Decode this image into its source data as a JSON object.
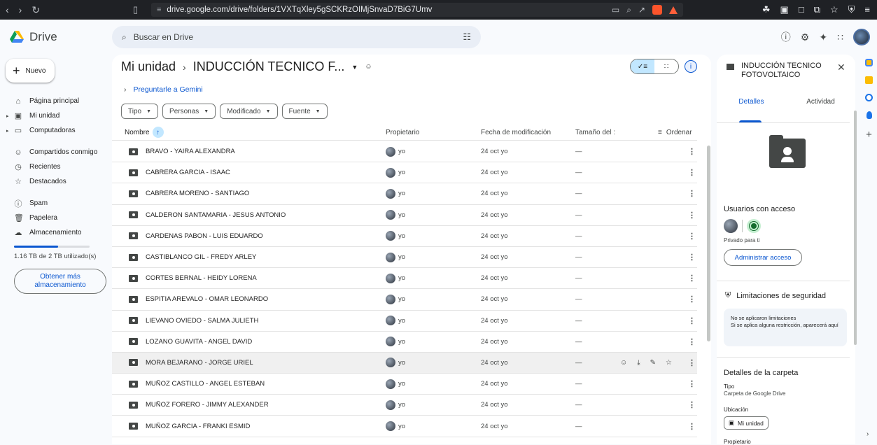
{
  "browser": {
    "url": "drive.google.com/drive/folders/1VXTqXley5gSCKRzOIMjSnvaD7BiG7Umv"
  },
  "header": {
    "app_name": "Drive",
    "search_placeholder": "Buscar en Drive"
  },
  "sidebar": {
    "new_label": "Nuevo",
    "items": [
      {
        "label": "Página principal",
        "icon": "home-icon"
      },
      {
        "label": "Mi unidad",
        "icon": "my-drive-icon"
      },
      {
        "label": "Computadoras",
        "icon": "computer-icon"
      },
      {
        "label": "Compartidos conmigo",
        "icon": "shared-icon"
      },
      {
        "label": "Recientes",
        "icon": "clock-icon"
      },
      {
        "label": "Destacados",
        "icon": "star-icon"
      },
      {
        "label": "Spam",
        "icon": "spam-icon"
      },
      {
        "label": "Papelera",
        "icon": "trash-icon"
      },
      {
        "label": "Almacenamiento",
        "icon": "cloud-icon"
      }
    ],
    "storage_used_fraction": 0.58,
    "storage_text": "1.16 TB de 2 TB utilizado(s)",
    "get_more_label": "Obtener más almacenamiento"
  },
  "main": {
    "breadcrumb_root": "Mi unidad",
    "breadcrumb_current": "INDUCCIÓN TECNICO F...",
    "gemini_label": "Preguntarle a Gemini",
    "filters": [
      "Tipo",
      "Personas",
      "Modificado",
      "Fuente"
    ],
    "columns": {
      "name": "Nombre",
      "owner": "Propietario",
      "modified": "Fecha de modificación",
      "size": "Tamaño del :",
      "sort": "Ordenar"
    },
    "rows": [
      {
        "name": "BRAVO - YAIRA ALEXANDRA",
        "owner": "yo",
        "modified": "24 oct yo",
        "size": "—"
      },
      {
        "name": "CABRERA GARCIA - ISAAC",
        "owner": "yo",
        "modified": "24 oct yo",
        "size": "—"
      },
      {
        "name": "CABRERA MORENO - SANTIAGO",
        "owner": "yo",
        "modified": "24 oct yo",
        "size": "—"
      },
      {
        "name": "CALDERON SANTAMARIA - JESUS ANTONIO",
        "owner": "yo",
        "modified": "24 oct yo",
        "size": "—"
      },
      {
        "name": "CARDENAS PABON - LUIS EDUARDO",
        "owner": "yo",
        "modified": "24 oct yo",
        "size": "—"
      },
      {
        "name": "CASTIBLANCO GIL - FREDY ARLEY",
        "owner": "yo",
        "modified": "24 oct yo",
        "size": "—"
      },
      {
        "name": "CORTES BERNAL - HEIDY LORENA",
        "owner": "yo",
        "modified": "24 oct yo",
        "size": "—"
      },
      {
        "name": "ESPITIA AREVALO - OMAR LEONARDO",
        "owner": "yo",
        "modified": "24 oct yo",
        "size": "—"
      },
      {
        "name": "LIEVANO OVIEDO - SALMA JULIETH",
        "owner": "yo",
        "modified": "24 oct yo",
        "size": "—"
      },
      {
        "name": "LOZANO GUAVITA - ANGEL DAVID",
        "owner": "yo",
        "modified": "24 oct yo",
        "size": "—"
      },
      {
        "name": "MORA BEJARANO - JORGE URIEL",
        "owner": "yo",
        "modified": "24 oct yo",
        "size": "—"
      },
      {
        "name": "MUÑOZ CASTILLO - ANGEL ESTEBAN",
        "owner": "yo",
        "modified": "24 oct yo",
        "size": "—"
      },
      {
        "name": "MUÑOZ FORERO - JIMMY ALEXANDER",
        "owner": "yo",
        "modified": "24 oct yo",
        "size": "—"
      },
      {
        "name": "MUÑOZ GARCIA - FRANKI ESMID",
        "owner": "yo",
        "modified": "24 oct yo",
        "size": "—"
      }
    ]
  },
  "panel": {
    "title": "INDUCCIÓN TECNICO FOTOVOLTAICO",
    "tab_details": "Detalles",
    "tab_activity": "Actividad",
    "access_title": "Usuarios con acceso",
    "private_text": "Privado para ti",
    "manage_access": "Administrar acceso",
    "security_title": "Limitaciones de seguridad",
    "security_line1": "No se aplicaron limitaciones",
    "security_line2": "Si se aplica alguna restricción, aparecerá aquí",
    "details_title": "Detalles de la carpeta",
    "type_label": "Tipo",
    "type_value": "Carpeta de Google Drive",
    "location_label": "Ubicación",
    "location_value": "Mi unidad",
    "owner_label": "Propietario"
  },
  "colors": {
    "accent": "#0b57d0",
    "selected": "#c2e7ff"
  }
}
